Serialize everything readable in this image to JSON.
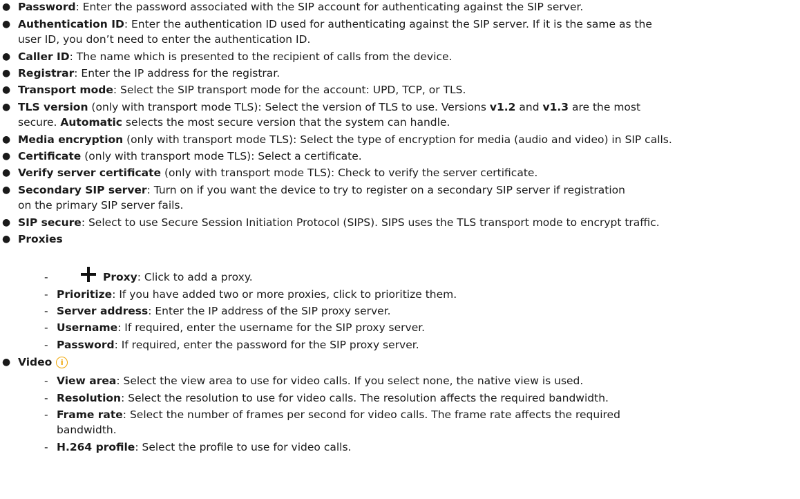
{
  "items": {
    "password": {
      "term": "Password",
      "text": ": Enter the password associated with the SIP account for authenticating against the SIP server."
    },
    "auth_id": {
      "term": "Authentication ID",
      "text": ": Enter the authentication ID used for authenticating against the SIP server. If it is the same as the",
      "text2": "user ID, you don’t need to enter the authentication ID."
    },
    "caller_id": {
      "term": "Caller ID",
      "text": ": The name which is presented to the recipient of calls from the device."
    },
    "registrar": {
      "term": "Registrar",
      "text": ": Enter the IP address for the registrar."
    },
    "transport": {
      "term": "Transport mode",
      "text": ": Select the SIP transport mode for the account: UPD, TCP, or TLS."
    },
    "tls_version": {
      "term": "TLS version",
      "text_a": " (only with transport mode TLS): Select the version of TLS to use. Versions ",
      "v12": "v1.2",
      "and": " and ",
      "v13": "v1.3",
      "text_b": " are the most",
      "line2_a": "secure. ",
      "automatic": "Automatic",
      "line2_b": " selects the most secure version that the system can handle."
    },
    "media_enc": {
      "term": "Media encryption",
      "text": " (only with transport mode TLS): Select the type of encryption for media (audio and video) in SIP calls."
    },
    "certificate": {
      "term": "Certificate",
      "text": " (only with transport mode TLS): Select a certificate."
    },
    "verify_cert": {
      "term": "Verify server certificate",
      "text": " (only with transport mode TLS): Check to verify the server certificate."
    },
    "secondary": {
      "term": "Secondary SIP server",
      "text": ": Turn on if you want the device to try to register on a secondary SIP server if registration",
      "text2": "on the primary SIP server fails."
    },
    "sip_secure": {
      "term": "SIP secure",
      "text": ": Select to use Secure Session Initiation Protocol (SIPS). SIPS uses the TLS transport mode to encrypt traffic."
    },
    "proxies": {
      "term": "Proxies"
    },
    "video": {
      "term": "Video"
    }
  },
  "proxies_sub": [
    {
      "term": "Proxy",
      "text": ": Click to add a proxy."
    },
    {
      "term": "Prioritize",
      "text": ": If you have added two or more proxies, click to prioritize them."
    },
    {
      "term": "Server address",
      "text": ": Enter the IP address of the SIP proxy server."
    },
    {
      "term": "Username",
      "text": ": If required, enter the username for the SIP proxy server."
    },
    {
      "term": "Password",
      "text": ": If required, enter the password for the SIP proxy server."
    }
  ],
  "video_sub": [
    {
      "term": "View area",
      "text": ": Select the view area to use for video calls. If you select none, the native view is used."
    },
    {
      "term": "Resolution",
      "text": ": Select the resolution to use for video calls. The resolution affects the required bandwidth."
    },
    {
      "term": "Frame rate",
      "text": ": Select the number of frames per second for video calls. The frame rate affects the required",
      "text2": "bandwidth."
    },
    {
      "term": "H.264 profile",
      "text": ": Select the profile to use for video calls."
    }
  ],
  "icons": {
    "add": "plus-icon",
    "info": "info-icon",
    "info_glyph": "i",
    "info_color": "#f0a500"
  }
}
